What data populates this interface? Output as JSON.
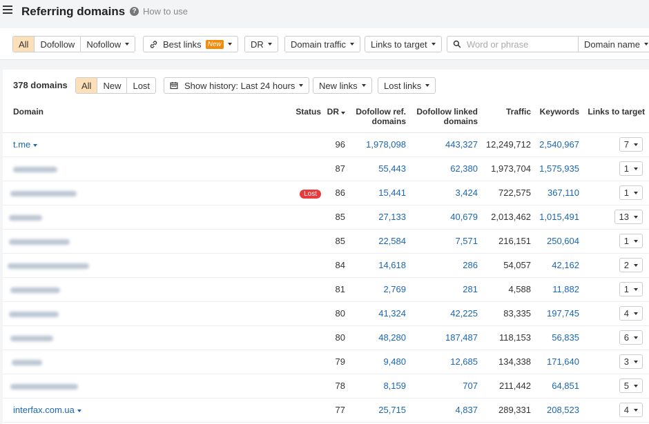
{
  "header": {
    "title": "Referring domains",
    "help": "How to use"
  },
  "filters": {
    "link_type": [
      "All",
      "Dofollow",
      "Nofollow"
    ],
    "best_links": "Best links",
    "best_links_badge": "New",
    "dr": "DR",
    "domain_traffic": "Domain traffic",
    "links_to_target": "Links to target",
    "search_placeholder": "Word or phrase",
    "search_scope": "Domain name"
  },
  "summary": {
    "count": "378 domains",
    "status_tabs": [
      "All",
      "New",
      "Lost"
    ],
    "history": "Show history: Last 24 hours",
    "new_links": "New links",
    "lost_links": "Lost links"
  },
  "table": {
    "columns": {
      "domain": "Domain",
      "status": "Status",
      "dr": "DR",
      "dofollow_ref_1": "Dofollow ref.",
      "dofollow_ref_2": "domains",
      "dofollow_linked_1": "Dofollow linked",
      "dofollow_linked_2": "domains",
      "traffic": "Traffic",
      "keywords": "Keywords",
      "links_to_target": "Links to target"
    },
    "rows": [
      {
        "domain": "t.me",
        "status": "",
        "dr": "96",
        "ref": "1,978,098",
        "linked": "443,327",
        "traffic": "12,249,712",
        "keywords": "2,540,967",
        "links": "7"
      },
      {
        "domain": "",
        "status": "",
        "dr": "87",
        "ref": "55,443",
        "linked": "62,380",
        "traffic": "1,973,704",
        "keywords": "1,575,935",
        "links": "1"
      },
      {
        "domain": "",
        "status": "Lost",
        "dr": "86",
        "ref": "15,441",
        "linked": "3,424",
        "traffic": "722,575",
        "keywords": "367,110",
        "links": "1"
      },
      {
        "domain": "",
        "status": "",
        "dr": "85",
        "ref": "27,133",
        "linked": "40,679",
        "traffic": "2,013,462",
        "keywords": "1,015,491",
        "links": "13"
      },
      {
        "domain": "",
        "status": "",
        "dr": "85",
        "ref": "22,584",
        "linked": "7,571",
        "traffic": "216,151",
        "keywords": "250,604",
        "links": "1"
      },
      {
        "domain": "",
        "status": "",
        "dr": "84",
        "ref": "14,618",
        "linked": "286",
        "traffic": "54,057",
        "keywords": "42,162",
        "links": "2"
      },
      {
        "domain": "",
        "status": "",
        "dr": "81",
        "ref": "2,769",
        "linked": "281",
        "traffic": "4,588",
        "keywords": "11,882",
        "links": "1"
      },
      {
        "domain": "",
        "status": "",
        "dr": "80",
        "ref": "41,324",
        "linked": "42,225",
        "traffic": "83,335",
        "keywords": "197,745",
        "links": "4"
      },
      {
        "domain": "",
        "status": "",
        "dr": "80",
        "ref": "48,280",
        "linked": "187,487",
        "traffic": "118,153",
        "keywords": "56,835",
        "links": "6"
      },
      {
        "domain": "",
        "status": "",
        "dr": "79",
        "ref": "9,480",
        "linked": "12,685",
        "traffic": "134,338",
        "keywords": "171,640",
        "links": "3"
      },
      {
        "domain": "",
        "status": "",
        "dr": "78",
        "ref": "8,159",
        "linked": "707",
        "traffic": "211,442",
        "keywords": "64,851",
        "links": "5"
      },
      {
        "domain": "interfax.com.ua",
        "status": "",
        "dr": "77",
        "ref": "25,715",
        "linked": "4,837",
        "traffic": "289,331",
        "keywords": "208,523",
        "links": "4"
      }
    ]
  },
  "colors": {
    "accent": "#fde0b8",
    "link": "#1a66b5",
    "lost": "#e83b3b",
    "new_badge": "#f58a07"
  }
}
